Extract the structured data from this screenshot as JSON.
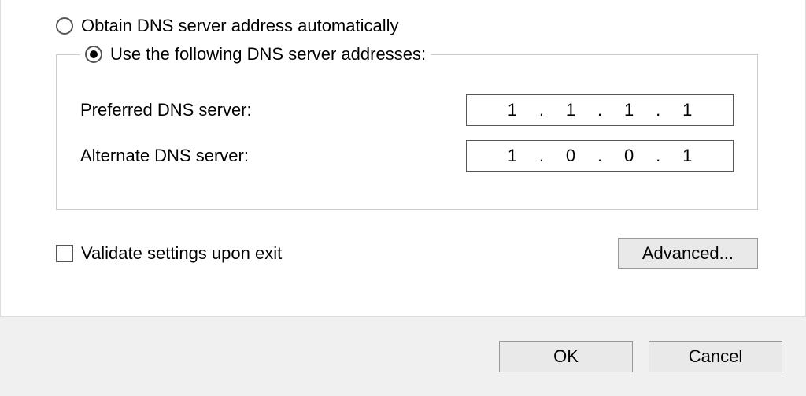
{
  "radio_obtain": {
    "label": "Obtain DNS server address automatically",
    "selected": false
  },
  "radio_use": {
    "label": "Use the following DNS server addresses:",
    "selected": true
  },
  "preferred": {
    "label": "Preferred DNS server:",
    "octets": [
      "1",
      "1",
      "1",
      "1"
    ]
  },
  "alternate": {
    "label": "Alternate DNS server:",
    "octets": [
      "1",
      "0",
      "0",
      "1"
    ]
  },
  "validate": {
    "label": "Validate settings upon exit",
    "checked": false
  },
  "advanced_button": "Advanced...",
  "ok_button": "OK",
  "cancel_button": "Cancel"
}
